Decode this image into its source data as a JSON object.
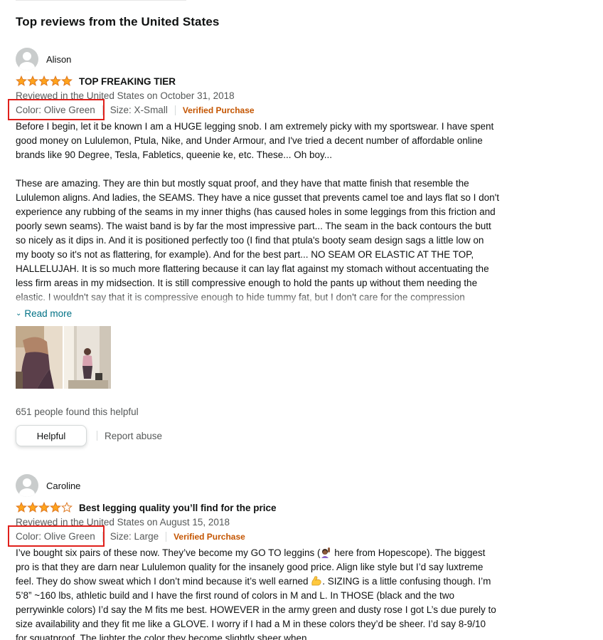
{
  "section_title": "Top reviews from the United States",
  "colors": {
    "star": "#ffa41c",
    "star_empty": "#ffffff",
    "star_outline": "#de7921",
    "verified": "#c45500",
    "link": "#007185",
    "highlight_box": "#e0201b"
  },
  "reviews": [
    {
      "name": "Alison",
      "rating": 5,
      "title": "TOP FREAKING TIER",
      "date": "Reviewed in the United States on October 31, 2018",
      "color": "Color: Olive Green",
      "size": "Size: X-Small",
      "verified": "Verified Purchase",
      "paragraph1": "Before I begin, let it be known I am a HUGE legging snob. I am extremely picky with my sportswear. I have spent good money on Lululemon, Ptula, Nike, and Under Armour, and I've tried a decent number of affordable online brands like 90 Degree, Tesla, Fabletics, queenie ke, etc. These... Oh boy...",
      "paragraph2": "These are amazing. They are thin but mostly squat proof, and they have that matte finish that resemble the Lululemon aligns. And ladies, the SEAMS. They have a nice gusset that prevents camel toe and lays flat so I don't experience any rubbing of the seams in my inner thighs (has caused holes in some leggings from this friction and poorly sewn seams). The waist band is by far the most impressive part... The seam in the back contours the butt so nicely as it dips in. And it is positioned perfectly too (I find that ptula's booty seam design sags a little low on my booty so it's not as flattering, for example). And for the best part... NO SEAM OR ELASTIC AT THE TOP, HALLELUJAH. It is so much more flattering because it can lay flat against my stomach without accentuating the less firm areas in my midsection. It is still compressive enough to hold the pants up without them needing the elastic. I wouldn't say that it is compressive enough to hide tummy fat, but I don't care for the compression personally.",
      "read_more": "Read more",
      "helpful_count": "651 people found this helpful",
      "helpful_button": "Helpful",
      "report": "Report abuse"
    },
    {
      "name": "Caroline",
      "rating": 4,
      "title": "Best legging quality you’ll find for the price",
      "date": "Reviewed in the United States on August 15, 2018",
      "color": "Color: Olive Green",
      "size": "Size: Large",
      "verified": "Verified Purchase",
      "body_a": "I’ve bought six pairs of these now. They’ve become my GO TO leggins (",
      "body_b": " here from Hopescope). The biggest pro is that they are darn near Lululemon quality for the insanely good price. Align like style but I’d say luxtreme feel. They do show sweat which I don’t mind because it’s well earned ",
      "body_c": ". SIZING is a little confusing though. I’m 5’8” ~160 lbs, athletic build and I have the first round of colors in M and L. In THOSE (black and the two perrywinkle colors) I’d say the M fits me best. HOWEVER in the army green and dusty rose I got L’s due purely to size availability and they fit me like a GLOVE. I worry if I had a M in these colors they’d be sheer. I’d say 8-9/10 for squatproof. The lighter the color they become slightly sheer when"
    }
  ]
}
